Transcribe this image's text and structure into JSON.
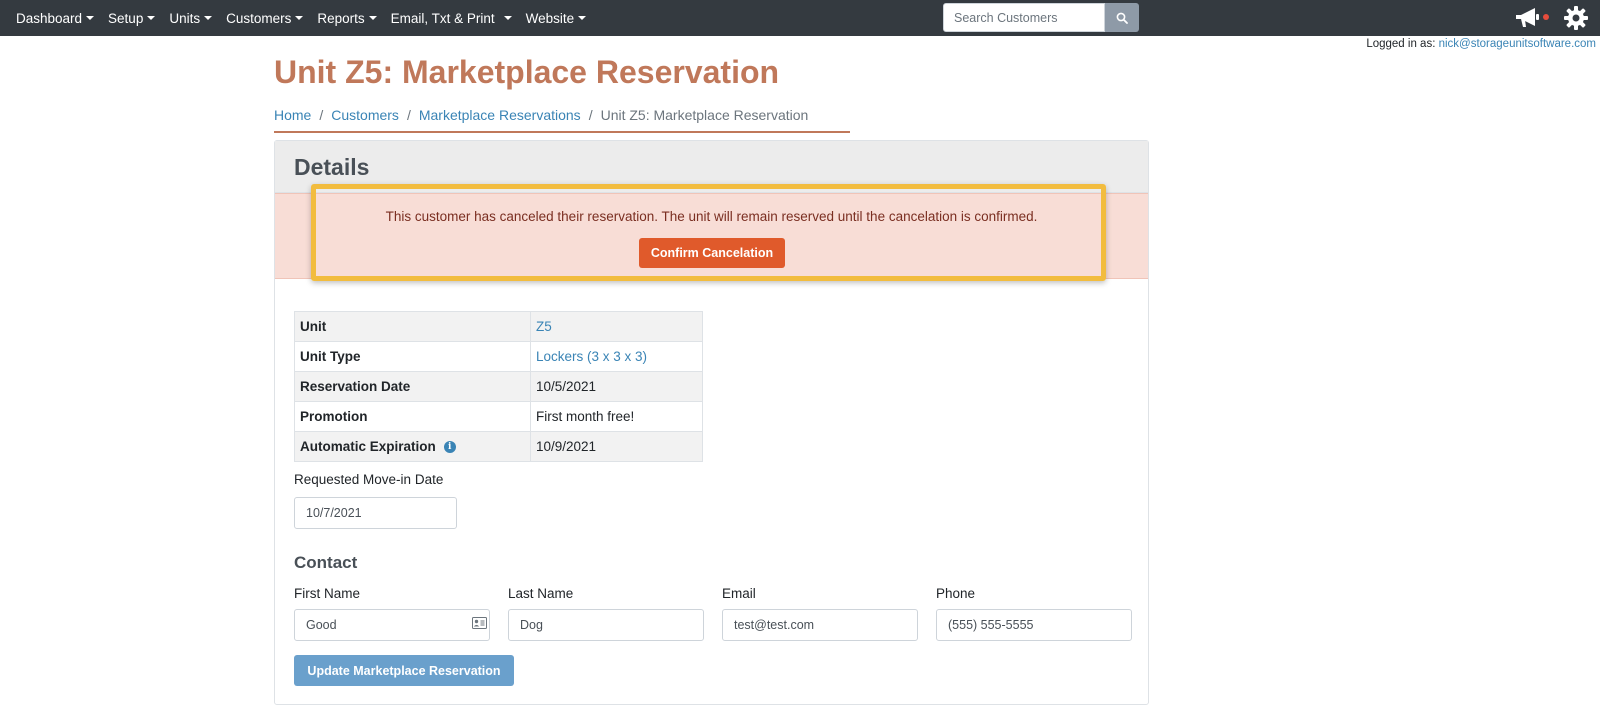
{
  "nav": {
    "items": [
      {
        "label": "Dashboard"
      },
      {
        "label": "Setup"
      },
      {
        "label": "Units"
      },
      {
        "label": "Customers"
      },
      {
        "label": "Reports"
      },
      {
        "label": "Email, Txt & Print"
      },
      {
        "label": "Website"
      }
    ],
    "search_placeholder": "Search Customers",
    "icons": [
      "search-icon",
      "megaphone-icon",
      "gear-icon"
    ],
    "notification_dot_color": "#e74c3c"
  },
  "user": {
    "logged_in_label": "Logged in as:",
    "email": "nick@storageunitsoftware.com"
  },
  "page": {
    "title": "Unit Z5: Marketplace Reservation",
    "breadcrumb": [
      "Home",
      "Customers",
      "Marketplace Reservations",
      "Unit Z5: Marketplace Reservation"
    ]
  },
  "details": {
    "heading": "Details",
    "alert_text": "This customer has canceled their reservation. The unit will remain reserved until the cancelation is confirmed.",
    "confirm_label": "Confirm Cancelation",
    "rows": [
      {
        "label": "Unit",
        "value": "Z5"
      },
      {
        "label": "Unit Type",
        "value": "Lockers (3 x 3 x 3)"
      },
      {
        "label": "Reservation Date",
        "value": "10/5/2021"
      },
      {
        "label": "Promotion",
        "value": "First month free!"
      },
      {
        "label": "Automatic Expiration",
        "value": "10/9/2021"
      }
    ],
    "move_in": {
      "label": "Requested Move-in Date",
      "value": "10/7/2021"
    }
  },
  "contact": {
    "heading": "Contact",
    "first_name": {
      "label": "First Name",
      "value": "Good"
    },
    "last_name": {
      "label": "Last Name",
      "value": "Dog"
    },
    "email": {
      "label": "Email",
      "value": "test@test.com"
    },
    "phone": {
      "label": "Phone",
      "value": "(555) 555-5555"
    }
  },
  "update_label": "Update Marketplace Reservation",
  "colors": {
    "navbar": "#343a40",
    "title": "#c0785a",
    "link": "#3a84b5",
    "alert_bg": "#f8ddd6",
    "confirm_button": "#e05a2b",
    "highlight": "#f2bc3e",
    "update_button": "#6aa0cc"
  }
}
